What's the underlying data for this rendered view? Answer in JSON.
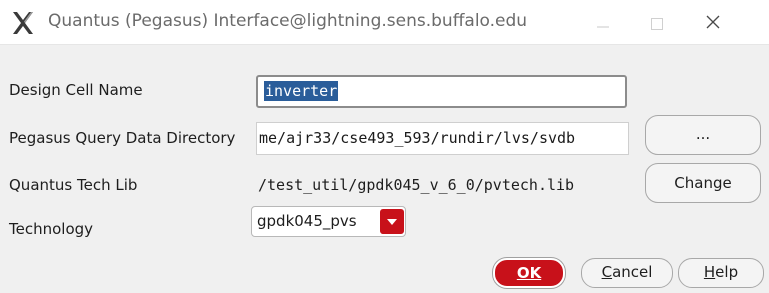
{
  "window": {
    "title": "Quantus (Pegasus) Interface@lightning.sens.buffalo.edu",
    "app_icon": "x-logo-icon",
    "controls": [
      "minimize-icon",
      "maximize-icon",
      "close-icon"
    ]
  },
  "form": {
    "design_cell_name": {
      "label": "Design Cell Name",
      "value": "inverter"
    },
    "query_data_dir": {
      "label": "Pegasus Query Data Directory",
      "value": "me/ajr33/cse493_593/rundir/lvs/svdb"
    },
    "tech_lib": {
      "label": "Quantus Tech Lib",
      "value": "/test_util/gpdk045_v_6_0/pvtech.lib"
    },
    "technology": {
      "label": "Technology",
      "value": "gpdk045_pvs"
    }
  },
  "buttons": {
    "browse": "...",
    "change": "Change",
    "ok": "OK",
    "cancel_first": "C",
    "cancel_rest": "ancel",
    "help_first": "H",
    "help_rest": "elp"
  },
  "colors": {
    "accent_red": "#c8111a",
    "selection": "#2a5d9a",
    "background": "#f0f0f0"
  }
}
